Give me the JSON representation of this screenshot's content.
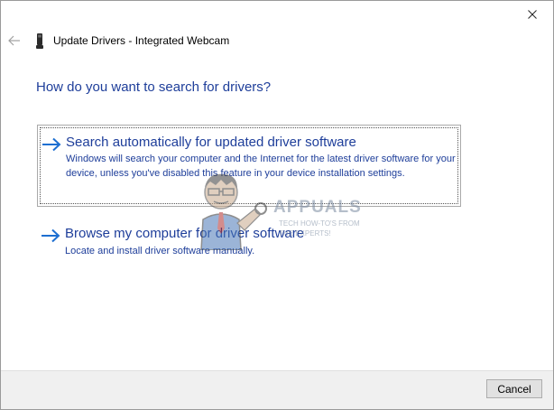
{
  "window": {
    "title": "Update Drivers - Integrated Webcam",
    "back_icon": "back-arrow-icon",
    "close_icon": "close-icon",
    "device_icon": "webcam-device-icon"
  },
  "main": {
    "heading": "How do you want to search for drivers?",
    "options": [
      {
        "title": "Search automatically for updated driver software",
        "description": "Windows will search your computer and the Internet for the latest driver software for your device, unless you've disabled this feature in your device installation settings.",
        "icon": "right-arrow-icon",
        "focused": true
      },
      {
        "title": "Browse my computer for driver software",
        "description": "Locate and install driver software manually.",
        "icon": "right-arrow-icon",
        "focused": false
      }
    ]
  },
  "watermark": {
    "brand": "APPUALS",
    "tagline_1": "TECH HOW-TO'S FROM",
    "tagline_2": "THE EXPERTS!"
  },
  "footer": {
    "cancel_label": "Cancel"
  },
  "colors": {
    "link_blue": "#1e3e9a",
    "arrow_blue": "#1d6fd1",
    "footer_bg": "#f0f0f0"
  }
}
